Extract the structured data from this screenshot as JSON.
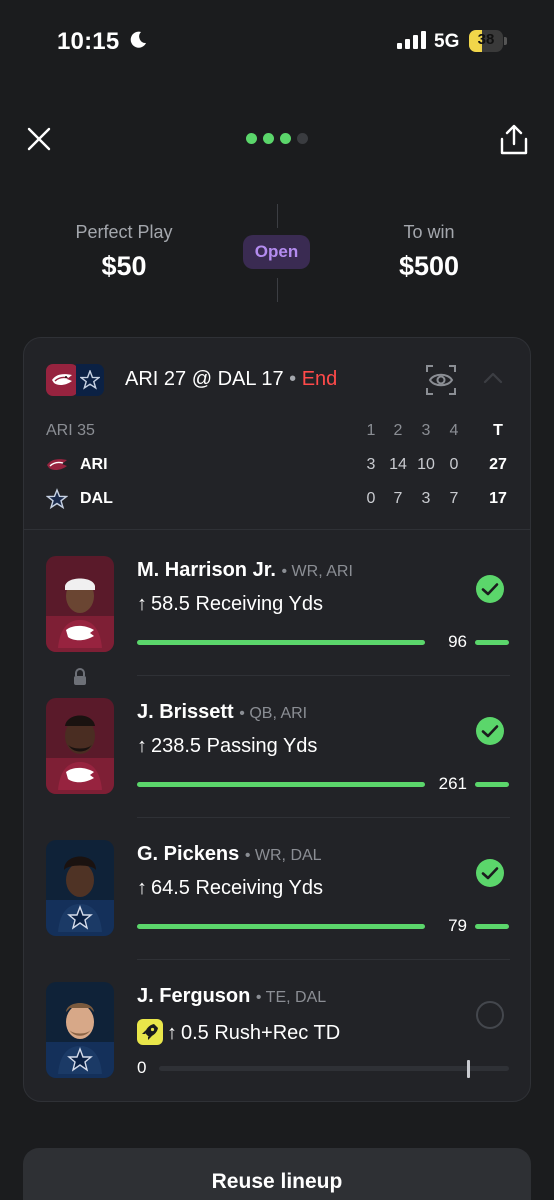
{
  "status_bar": {
    "time": "10:15",
    "network": "5G",
    "battery": "38",
    "battery_level": 0.38
  },
  "nav": {
    "dots_total": 4,
    "dots_active": 3,
    "accent": "#5bd66b"
  },
  "summary": {
    "left_label": "Perfect Play",
    "left_value": "$50",
    "status": "Open",
    "right_label": "To win",
    "right_value": "$500"
  },
  "game": {
    "away_abbr": "ARI",
    "away_score": "27",
    "home_abbr": "DAL",
    "home_score": "17",
    "at": "@",
    "bullet": "•",
    "state": "End",
    "state_color": "#ff4a4a"
  },
  "scoreboard": {
    "situation": "ARI 35",
    "quarters": [
      "1",
      "2",
      "3",
      "4"
    ],
    "total_label": "T",
    "rows": [
      {
        "team": "ARI",
        "q": [
          "3",
          "14",
          "10",
          "0"
        ],
        "total": "27"
      },
      {
        "team": "DAL",
        "q": [
          "0",
          "7",
          "3",
          "7"
        ],
        "total": "17"
      }
    ]
  },
  "picks": [
    {
      "name": "M. Harrison Jr.",
      "meta": "• WR, ARI",
      "direction": "↑",
      "line": "58.5 Receiving Yds",
      "actual": "96",
      "line_value": 58.5,
      "actual_value": 96,
      "status": "hit",
      "team": "ARI"
    },
    {
      "name": "J. Brissett",
      "meta": "• QB, ARI",
      "direction": "↑",
      "line": "238.5 Passing Yds",
      "actual": "261",
      "line_value": 238.5,
      "actual_value": 261,
      "status": "hit",
      "team": "ARI"
    },
    {
      "name": "G. Pickens",
      "meta": "• WR, DAL",
      "direction": "↑",
      "line": "64.5 Receiving Yds",
      "actual": "79",
      "line_value": 64.5,
      "actual_value": 79,
      "status": "hit",
      "team": "DAL"
    },
    {
      "name": "J. Ferguson",
      "meta": "• TE, DAL",
      "direction": "↑",
      "line": "0.5 Rush+Rec TD",
      "actual": "0",
      "line_value": 0.5,
      "actual_value": 0,
      "status": "pending",
      "team": "DAL",
      "booster": "rocket-icon"
    }
  ],
  "footer": {
    "reuse_label": "Reuse lineup"
  }
}
